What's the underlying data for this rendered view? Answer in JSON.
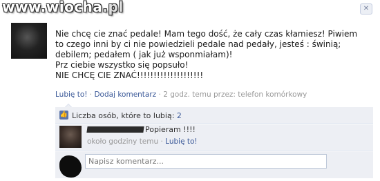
{
  "watermark": {
    "prefix": "www.",
    "brand": "wiocha",
    "tld": ".pl"
  },
  "post": {
    "text": "Nie chcę cie znać pedale! Mam tego dość, że cały czas kłamiesz! Piwiem\nto czego inni by ci nie powiedzieli pedale nad pedały, jesteś : świnią;\ndebilem; pedałem ( jak już wsponmiałam)!\nPrz ciebie wszystko się popsuło!\nNIE CHCĘ CIE ZNAĆ!!!!!!!!!!!!!!!!!!!!",
    "like_label": "Lubię to!",
    "comment_label": "Dodaj komentarz",
    "timestamp": "2 godz. temu przez: telefon komórkowy",
    "separator": " · "
  },
  "likes": {
    "label": "Liczba osób, które to lubią:",
    "count": "2"
  },
  "comment": {
    "text": "Popieram !!!!",
    "time": "około godziny temu",
    "like_label": "Lubię to!",
    "separator": " · "
  },
  "composer": {
    "placeholder": "Napisz komentarz..."
  },
  "colors": {
    "link": "#3b5998",
    "ufi_background": "#edeff4",
    "meta_text": "#999999"
  }
}
